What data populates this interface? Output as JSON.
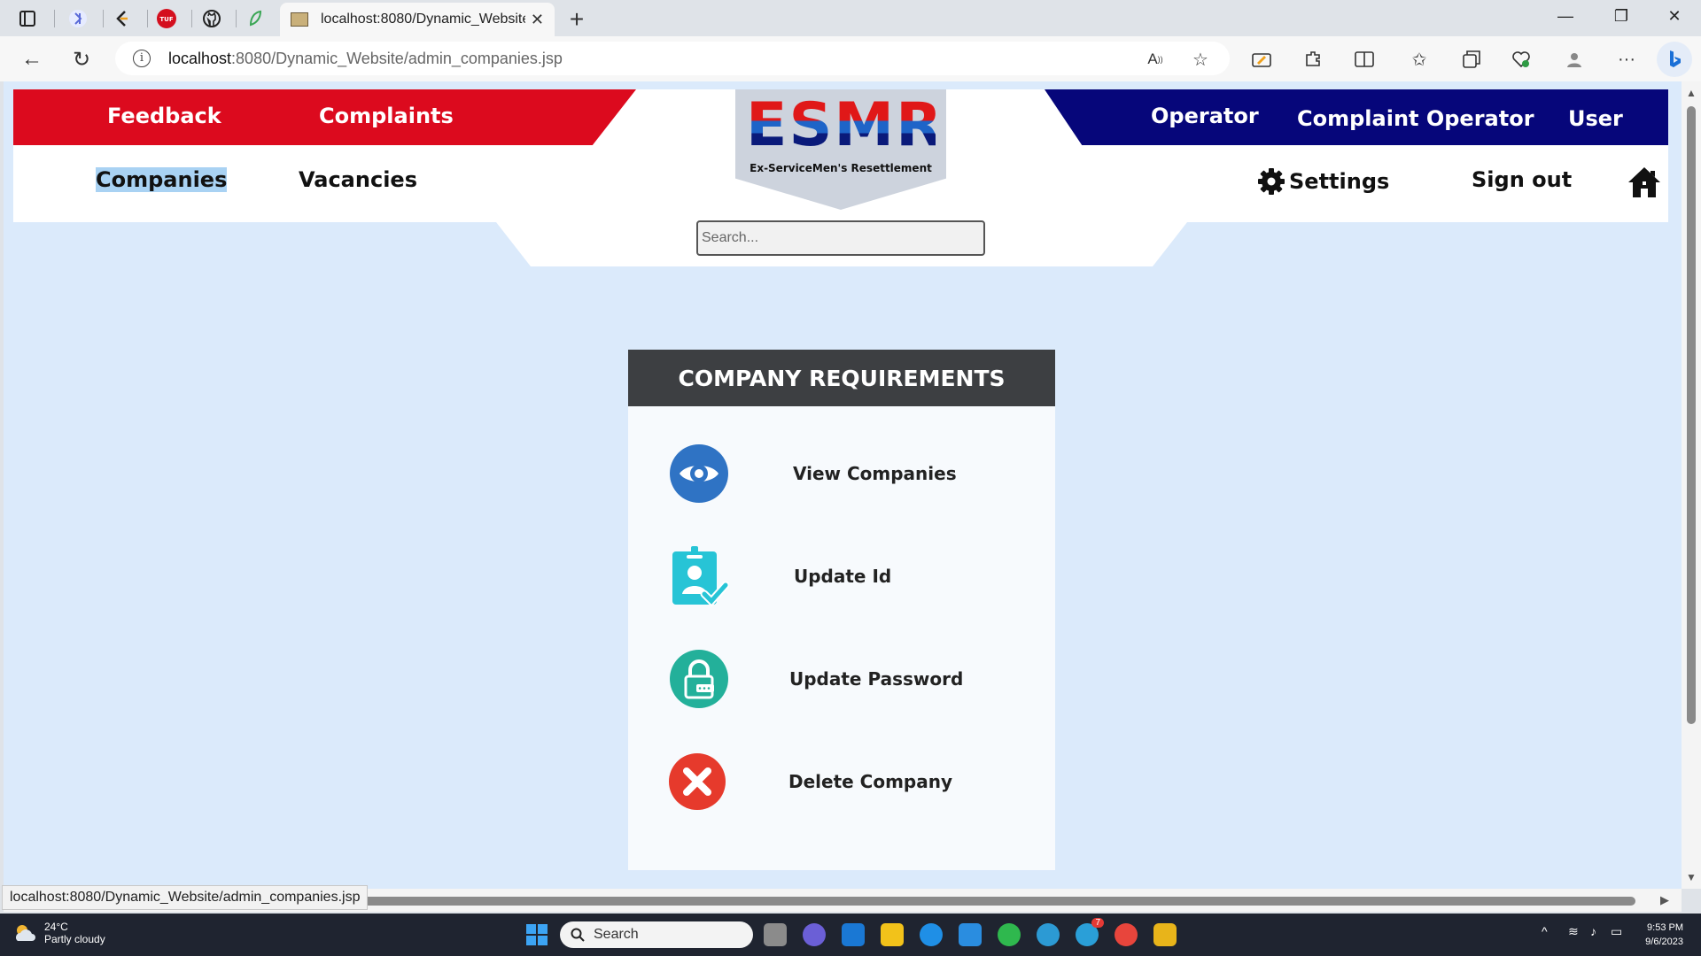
{
  "browser": {
    "active_tab_title": "localhost:8080/Dynamic_Website",
    "url_host": "localhost",
    "url_path": ":8080/Dynamic_Website/admin_companies.jsp",
    "status_url": "localhost:8080/Dynamic_Website/admin_companies.jsp",
    "pinned_tabs": [
      "perplexity-icon",
      "leetcode-icon",
      "tuf-icon",
      "github-icon",
      "leaf-icon"
    ]
  },
  "header": {
    "left_links": [
      "Feedback",
      "Complaints"
    ],
    "right_links": [
      "Operator",
      "Complaint Operator",
      "User"
    ],
    "sub_links": [
      "Companies",
      "Vacancies"
    ],
    "settings_label": "Settings",
    "signout_label": "Sign out",
    "logo_text": "ESMR",
    "logo_tagline": "Ex-ServiceMen's Resettlement",
    "search_placeholder": "Search...",
    "colors": {
      "red": "#dc0a1e",
      "navy": "#06067a",
      "page_bg": "#dbeafb"
    }
  },
  "card": {
    "title": "COMPANY REQUIREMENTS",
    "items": [
      {
        "label": "View Companies",
        "icon": "eye-icon"
      },
      {
        "label": "Update Id",
        "icon": "id-badge-icon"
      },
      {
        "label": "Update Password",
        "icon": "lock-icon"
      },
      {
        "label": "Delete Company",
        "icon": "close-circle-icon"
      }
    ]
  },
  "taskbar": {
    "temperature": "24°C",
    "weather": "Partly cloudy",
    "search_label": "Search",
    "time": "9:53 PM",
    "date": "9/6/2023",
    "telegram_badge": "7"
  }
}
